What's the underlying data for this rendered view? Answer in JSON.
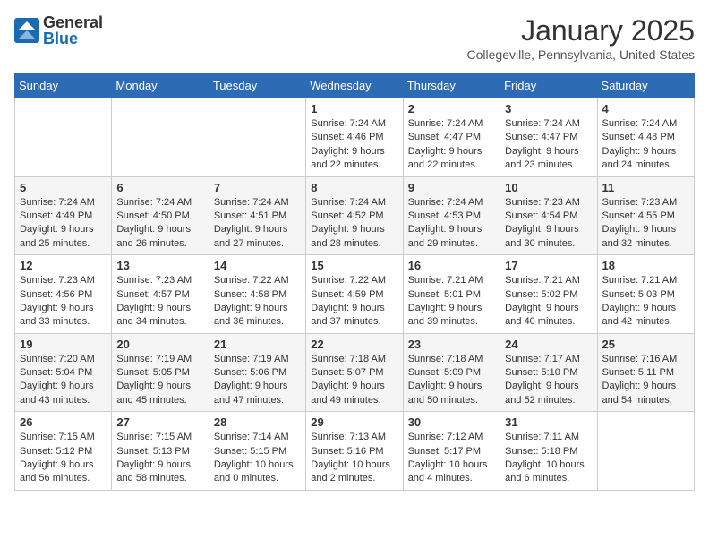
{
  "header": {
    "logo_general": "General",
    "logo_blue": "Blue",
    "title": "January 2025",
    "subtitle": "Collegeville, Pennsylvania, United States"
  },
  "weekdays": [
    "Sunday",
    "Monday",
    "Tuesday",
    "Wednesday",
    "Thursday",
    "Friday",
    "Saturday"
  ],
  "weeks": [
    [
      {
        "day": "",
        "info": ""
      },
      {
        "day": "",
        "info": ""
      },
      {
        "day": "",
        "info": ""
      },
      {
        "day": "1",
        "info": "Sunrise: 7:24 AM\nSunset: 4:46 PM\nDaylight: 9 hours\nand 22 minutes."
      },
      {
        "day": "2",
        "info": "Sunrise: 7:24 AM\nSunset: 4:47 PM\nDaylight: 9 hours\nand 22 minutes."
      },
      {
        "day": "3",
        "info": "Sunrise: 7:24 AM\nSunset: 4:47 PM\nDaylight: 9 hours\nand 23 minutes."
      },
      {
        "day": "4",
        "info": "Sunrise: 7:24 AM\nSunset: 4:48 PM\nDaylight: 9 hours\nand 24 minutes."
      }
    ],
    [
      {
        "day": "5",
        "info": "Sunrise: 7:24 AM\nSunset: 4:49 PM\nDaylight: 9 hours\nand 25 minutes."
      },
      {
        "day": "6",
        "info": "Sunrise: 7:24 AM\nSunset: 4:50 PM\nDaylight: 9 hours\nand 26 minutes."
      },
      {
        "day": "7",
        "info": "Sunrise: 7:24 AM\nSunset: 4:51 PM\nDaylight: 9 hours\nand 27 minutes."
      },
      {
        "day": "8",
        "info": "Sunrise: 7:24 AM\nSunset: 4:52 PM\nDaylight: 9 hours\nand 28 minutes."
      },
      {
        "day": "9",
        "info": "Sunrise: 7:24 AM\nSunset: 4:53 PM\nDaylight: 9 hours\nand 29 minutes."
      },
      {
        "day": "10",
        "info": "Sunrise: 7:23 AM\nSunset: 4:54 PM\nDaylight: 9 hours\nand 30 minutes."
      },
      {
        "day": "11",
        "info": "Sunrise: 7:23 AM\nSunset: 4:55 PM\nDaylight: 9 hours\nand 32 minutes."
      }
    ],
    [
      {
        "day": "12",
        "info": "Sunrise: 7:23 AM\nSunset: 4:56 PM\nDaylight: 9 hours\nand 33 minutes."
      },
      {
        "day": "13",
        "info": "Sunrise: 7:23 AM\nSunset: 4:57 PM\nDaylight: 9 hours\nand 34 minutes."
      },
      {
        "day": "14",
        "info": "Sunrise: 7:22 AM\nSunset: 4:58 PM\nDaylight: 9 hours\nand 36 minutes."
      },
      {
        "day": "15",
        "info": "Sunrise: 7:22 AM\nSunset: 4:59 PM\nDaylight: 9 hours\nand 37 minutes."
      },
      {
        "day": "16",
        "info": "Sunrise: 7:21 AM\nSunset: 5:01 PM\nDaylight: 9 hours\nand 39 minutes."
      },
      {
        "day": "17",
        "info": "Sunrise: 7:21 AM\nSunset: 5:02 PM\nDaylight: 9 hours\nand 40 minutes."
      },
      {
        "day": "18",
        "info": "Sunrise: 7:21 AM\nSunset: 5:03 PM\nDaylight: 9 hours\nand 42 minutes."
      }
    ],
    [
      {
        "day": "19",
        "info": "Sunrise: 7:20 AM\nSunset: 5:04 PM\nDaylight: 9 hours\nand 43 minutes."
      },
      {
        "day": "20",
        "info": "Sunrise: 7:19 AM\nSunset: 5:05 PM\nDaylight: 9 hours\nand 45 minutes."
      },
      {
        "day": "21",
        "info": "Sunrise: 7:19 AM\nSunset: 5:06 PM\nDaylight: 9 hours\nand 47 minutes."
      },
      {
        "day": "22",
        "info": "Sunrise: 7:18 AM\nSunset: 5:07 PM\nDaylight: 9 hours\nand 49 minutes."
      },
      {
        "day": "23",
        "info": "Sunrise: 7:18 AM\nSunset: 5:09 PM\nDaylight: 9 hours\nand 50 minutes."
      },
      {
        "day": "24",
        "info": "Sunrise: 7:17 AM\nSunset: 5:10 PM\nDaylight: 9 hours\nand 52 minutes."
      },
      {
        "day": "25",
        "info": "Sunrise: 7:16 AM\nSunset: 5:11 PM\nDaylight: 9 hours\nand 54 minutes."
      }
    ],
    [
      {
        "day": "26",
        "info": "Sunrise: 7:15 AM\nSunset: 5:12 PM\nDaylight: 9 hours\nand 56 minutes."
      },
      {
        "day": "27",
        "info": "Sunrise: 7:15 AM\nSunset: 5:13 PM\nDaylight: 9 hours\nand 58 minutes."
      },
      {
        "day": "28",
        "info": "Sunrise: 7:14 AM\nSunset: 5:15 PM\nDaylight: 10 hours\nand 0 minutes."
      },
      {
        "day": "29",
        "info": "Sunrise: 7:13 AM\nSunset: 5:16 PM\nDaylight: 10 hours\nand 2 minutes."
      },
      {
        "day": "30",
        "info": "Sunrise: 7:12 AM\nSunset: 5:17 PM\nDaylight: 10 hours\nand 4 minutes."
      },
      {
        "day": "31",
        "info": "Sunrise: 7:11 AM\nSunset: 5:18 PM\nDaylight: 10 hours\nand 6 minutes."
      },
      {
        "day": "",
        "info": ""
      }
    ]
  ]
}
